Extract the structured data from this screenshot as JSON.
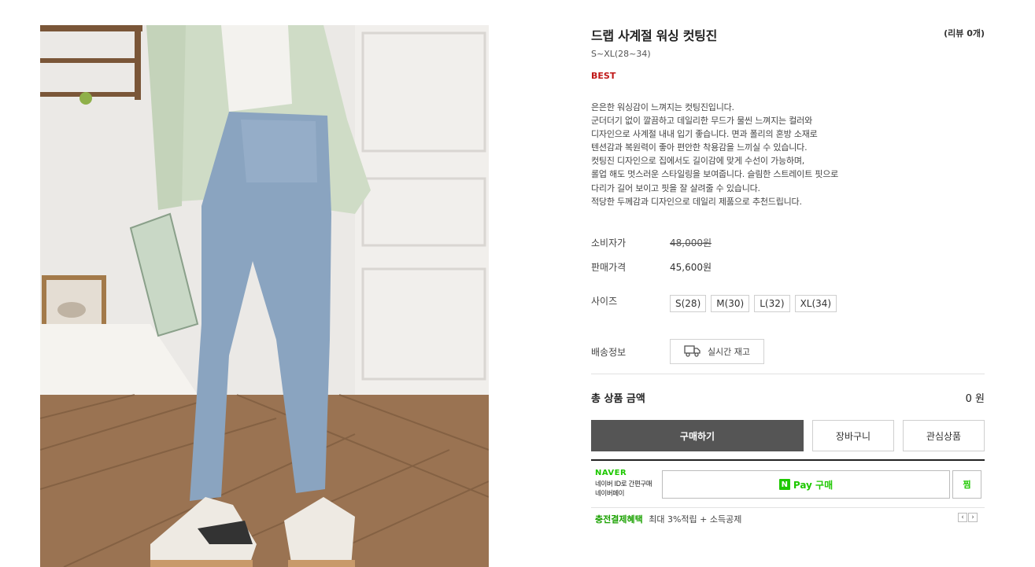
{
  "product": {
    "title": "드랩 사계절 워싱 컷팅진",
    "review_count": "(리뷰 0개)",
    "size_range": "S~XL(28~34)",
    "badge": "BEST",
    "badge_color": "#c01818",
    "description": [
      "은은한 워싱감이 느껴지는 컷팅진입니다.",
      "군더더기 없이 깔끔하고 데일리한 무드가 물씬 느껴지는 컬러와",
      "디자인으로 사계절 내내 입기 좋습니다. 면과 폴리의 혼방 소재로",
      "텐션감과 복원력이 좋아 편안한 착용감을 느끼실 수 있습니다.",
      "컷팅진 디자인으로 집에서도 길이감에 맞게 수선이 가능하며,",
      "롤업 해도 멋스러운 스타일링을 보여줍니다. 슬림한 스트레이트 핏으로",
      "다리가 길어 보이고 핏을 잘 살려줄 수 있습니다.",
      "적당한 두께감과 디자인으로 데일리 제품으로 추천드립니다."
    ]
  },
  "price": {
    "retail_label": "소비자가",
    "retail_value": "48,000원",
    "sale_label": "판매가격",
    "sale_value": "45,600원"
  },
  "size": {
    "label": "사이즈",
    "options": [
      "S(28)",
      "M(30)",
      "L(32)",
      "XL(34)"
    ]
  },
  "shipping": {
    "label": "배송정보",
    "button": "실시간 재고",
    "icon": "truck-icon"
  },
  "total": {
    "label": "총 상품 금액",
    "value": "0 원"
  },
  "actions": {
    "buy": "구매하기",
    "cart": "장바구니",
    "wish": "관심상품",
    "buy_color": "#555555"
  },
  "naver": {
    "logo": "NAVER",
    "desc_line1": "네이버 ID로 간편구매",
    "desc_line2": "네이버페이",
    "pay_badge": "N",
    "pay_label": "Pay 구매",
    "zzim": "찜",
    "benefit_link": "충전결제혜택",
    "benefit_text": "최대 3%적립 + 소득공제",
    "prev": "‹",
    "next": "›",
    "brand_color": "#1ec800"
  }
}
